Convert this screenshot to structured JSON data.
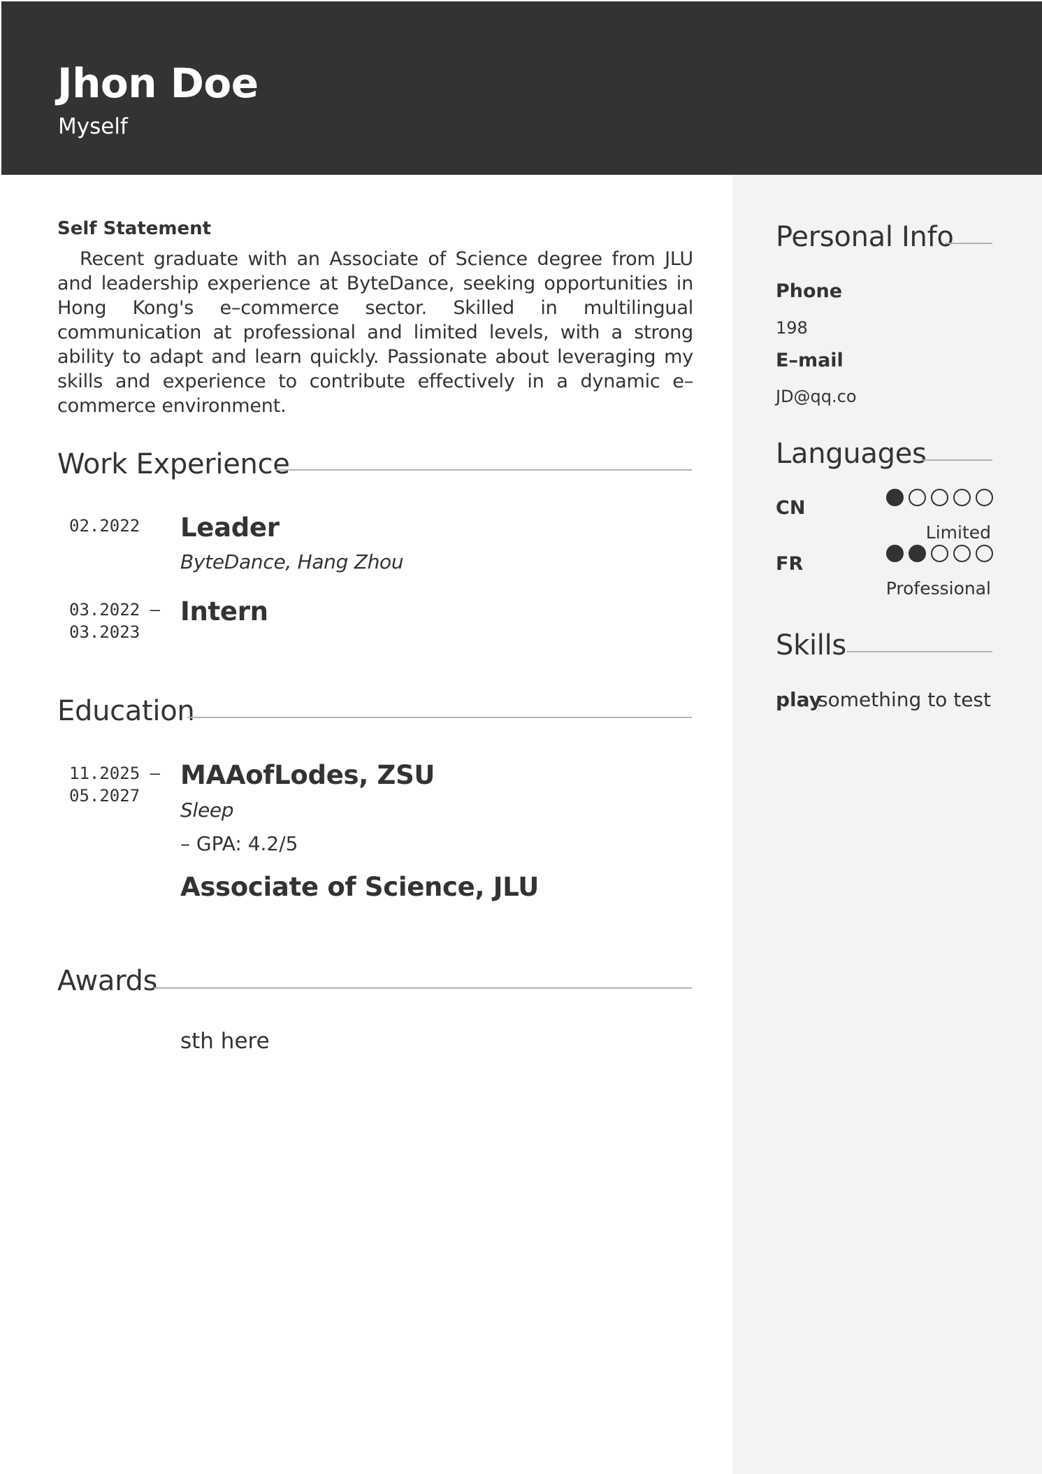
{
  "header": {
    "name": "Jhon Doe",
    "tagline": "Myself"
  },
  "self_statement": {
    "title": "Self Statement",
    "text": "Recent graduate with an Associate of Science degree from JLU and leadership experience at ByteDance, seeking opportunities in Hong Kong's e–commerce sector. Skilled in multilingual communication at professional and limited levels, with a strong ability to adapt and learn quickly. Passionate about leveraging my skills and experience to contribute effectively in a dynamic e–commerce environment."
  },
  "work_experience": {
    "title": "Work Experience",
    "entries": [
      {
        "date": "02.2022",
        "role": "Leader",
        "company": "ByteDance, Hang Zhou"
      },
      {
        "date": "03.2022 –\n03.2023",
        "role": "Intern"
      }
    ]
  },
  "education": {
    "title": "Education",
    "entries": [
      {
        "date": "11.2025 –\n05.2027",
        "degree": "MAAofLodes, ZSU",
        "field": "Sleep",
        "note": "– GPA: 4.2/5"
      },
      {
        "degree": "Associate of Science, JLU"
      }
    ]
  },
  "awards": {
    "title": "Awards",
    "items": [
      "sth here"
    ]
  },
  "personal_info": {
    "title": "Personal Info",
    "phone_label": "Phone",
    "phone": "198",
    "email_label": "E–mail",
    "email": "JD@qq.co"
  },
  "languages": {
    "title": "Languages",
    "items": [
      {
        "code": "CN",
        "level": "Limited",
        "dots_filled": 1,
        "dots_total": 5
      },
      {
        "code": "FR",
        "level": "Professional",
        "dots_filled": 2,
        "dots_total": 5
      }
    ]
  },
  "skills": {
    "title": "Skills",
    "items": [
      {
        "name": "play",
        "description": "something to test"
      }
    ]
  },
  "colors": {
    "header_bg": "#333333",
    "sidebar_bg": "#f3f3f3",
    "text": "#333333",
    "rule": "#b3b3b3"
  }
}
